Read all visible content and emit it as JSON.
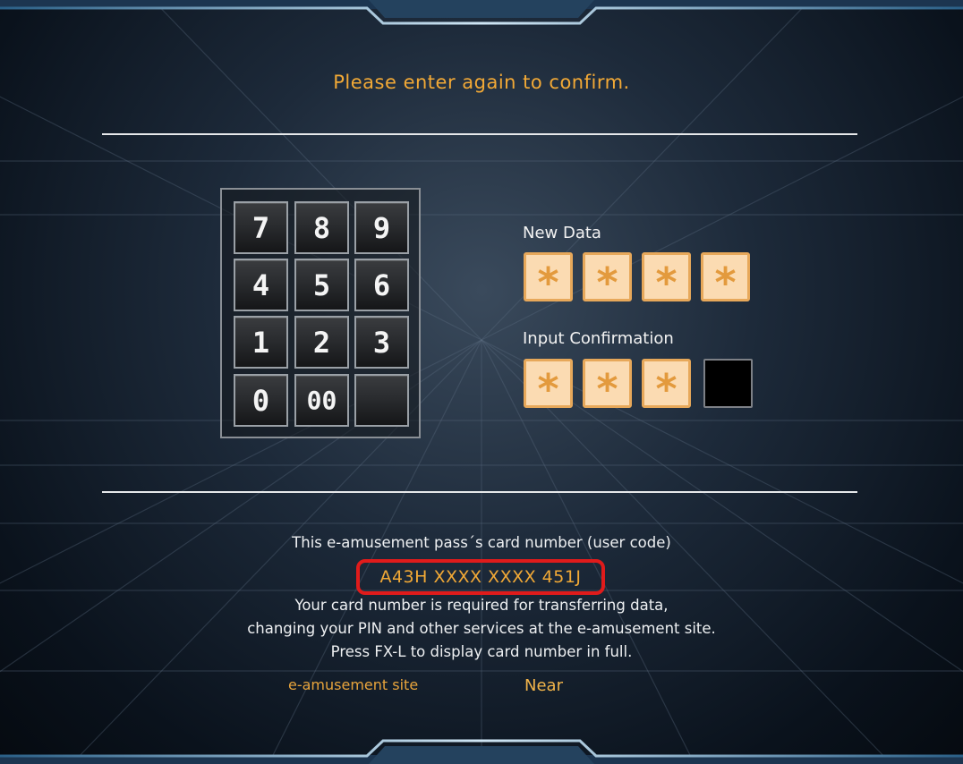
{
  "prompt": "Please enter again to confirm.",
  "keypad": {
    "keys": [
      "7",
      "8",
      "9",
      "4",
      "5",
      "6",
      "1",
      "2",
      "3",
      "0",
      "00",
      ""
    ]
  },
  "new_data": {
    "label": "New Data",
    "slots": [
      "*",
      "*",
      "*",
      "*"
    ]
  },
  "confirmation": {
    "label": "Input Confirmation",
    "slots": [
      "*",
      "*",
      "*",
      ""
    ]
  },
  "card_info": {
    "heading": "This e-amusement pass´s card number (user code)",
    "code": "A43H XXXX XXXX 451J",
    "line1": "Your card number is required for transferring data,",
    "line2": "changing your PIN and other services at the e-amusement site.",
    "line3": "Press FX-L to display card number in full."
  },
  "site_label": "e-amusement site",
  "near_label": "Near",
  "colors": {
    "accent": "#f2a936",
    "highlight_ring": "#e01b1b",
    "pin_box": "#fbdbb2"
  }
}
